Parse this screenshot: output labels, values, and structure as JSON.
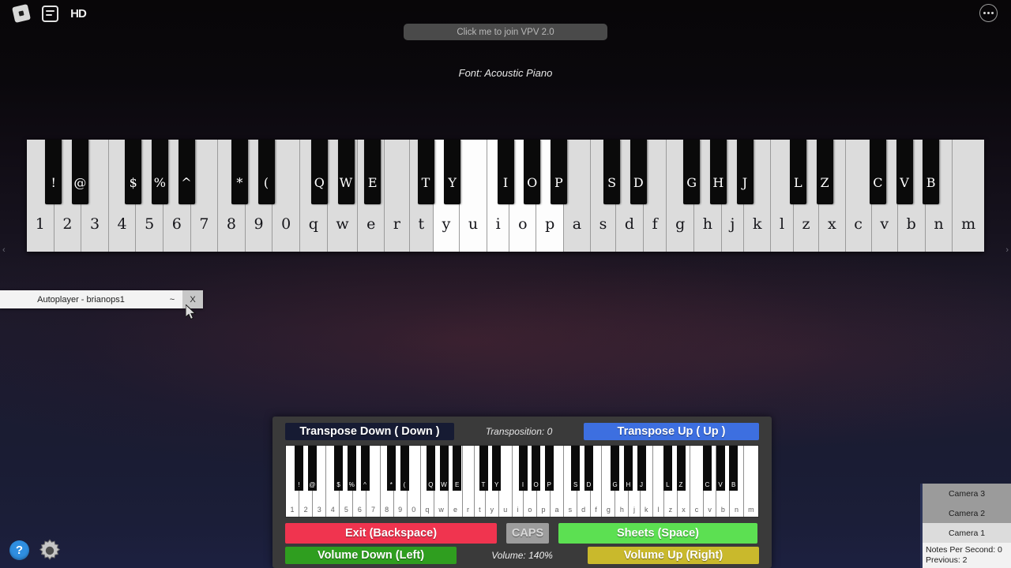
{
  "topbar": {
    "roblox_logo": "roblox-logo",
    "chat_icon": "chat-icon",
    "hd_label": "HD",
    "menu_icon": "more-options-icon"
  },
  "header": {
    "join_button": "Click me to join VPV 2.0",
    "font_label": "Font: Acoustic Piano"
  },
  "piano": {
    "white_keys": [
      "1",
      "2",
      "3",
      "4",
      "5",
      "6",
      "7",
      "8",
      "9",
      "0",
      "q",
      "w",
      "e",
      "r",
      "t",
      "y",
      "u",
      "i",
      "o",
      "p",
      "a",
      "s",
      "d",
      "f",
      "g",
      "h",
      "j",
      "k",
      "l",
      "z",
      "x",
      "c",
      "v",
      "b",
      "n",
      "m"
    ],
    "lit_white_keys": [
      "y",
      "u",
      "i",
      "o",
      "p"
    ],
    "black_keys": [
      {
        "label": "!",
        "after": 0
      },
      {
        "label": "@",
        "after": 1
      },
      {
        "label": "$",
        "after": 3
      },
      {
        "label": "%",
        "after": 4
      },
      {
        "label": "^",
        "after": 5
      },
      {
        "label": "*",
        "after": 7
      },
      {
        "label": "(",
        "after": 8
      },
      {
        "label": "Q",
        "after": 10
      },
      {
        "label": "W",
        "after": 11
      },
      {
        "label": "E",
        "after": 12
      },
      {
        "label": "T",
        "after": 14
      },
      {
        "label": "Y",
        "after": 15
      },
      {
        "label": "I",
        "after": 17
      },
      {
        "label": "O",
        "after": 18
      },
      {
        "label": "P",
        "after": 19
      },
      {
        "label": "S",
        "after": 21
      },
      {
        "label": "D",
        "after": 22
      },
      {
        "label": "G",
        "after": 24
      },
      {
        "label": "H",
        "after": 25
      },
      {
        "label": "J",
        "after": 26
      },
      {
        "label": "L",
        "after": 28
      },
      {
        "label": "Z",
        "after": 29
      },
      {
        "label": "C",
        "after": 31
      },
      {
        "label": "V",
        "after": 32
      },
      {
        "label": "B",
        "after": 33
      }
    ],
    "edge_left": "‹",
    "edge_right": "›"
  },
  "autoplayer": {
    "title": "Autoplayer - brianops1",
    "minimize_label": "~",
    "close_label": "X"
  },
  "panel": {
    "transpose_down": "Transpose Down ( Down )",
    "transposition": "Transposition: 0",
    "transpose_up": "Transpose Up (  Up  )",
    "exit": "Exit (Backspace)",
    "caps": "CAPS",
    "sheets": "Sheets (Space)",
    "volume_down": "Volume Down (Left)",
    "volume_label": "Volume: 140%",
    "volume_up": "Volume Up (Right)"
  },
  "camera": {
    "items": [
      "Camera 3",
      "Camera 2",
      "Camera 1"
    ],
    "active_index": 2,
    "notes_per_second": "Notes Per Second: 0",
    "previous": "Previous: 2"
  },
  "bottom_left": {
    "help_label": "?",
    "settings_icon": "gear-icon"
  },
  "colors": {
    "transpose_up": "#3d6fe0",
    "transpose_down": "#161b33",
    "exit": "#f0344f",
    "sheets": "#5ce052",
    "volume_down": "#2f9e1f",
    "volume_up": "#c9b92c",
    "caps": "#9d9d9d",
    "help": "#2f8ee0"
  }
}
